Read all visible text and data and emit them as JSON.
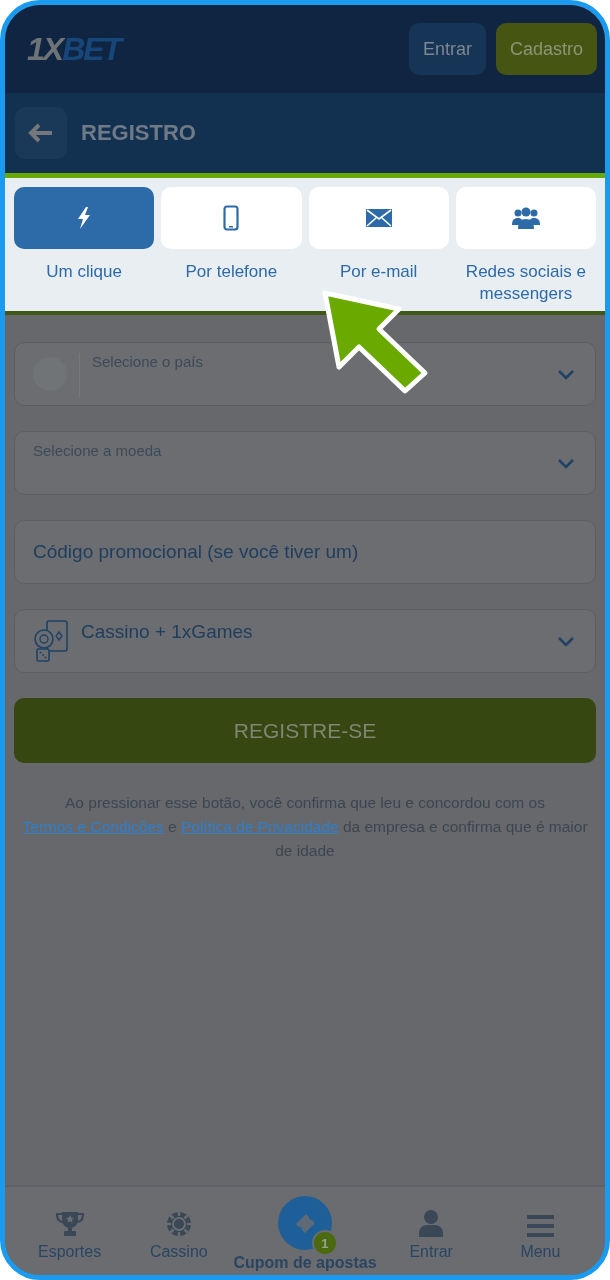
{
  "header": {
    "logo": {
      "prefix": "1X",
      "suffix": "BET"
    },
    "buttons": [
      {
        "kind": "login",
        "label": "Entrar"
      },
      {
        "kind": "signup",
        "label": "Cadastro"
      }
    ]
  },
  "page_title": "REGISTRO",
  "methods": [
    {
      "label": "Um clique",
      "selected": true
    },
    {
      "label": "Por telefone",
      "selected": false
    },
    {
      "label": "Por e-mail",
      "selected": false
    },
    {
      "label": "Redes sociais e messengers",
      "selected": false
    }
  ],
  "fields": [
    {
      "kind": "country",
      "label": "Selecione o país"
    },
    {
      "kind": "select",
      "label": "Selecione a moeda"
    },
    {
      "kind": "input",
      "placeholder": "Código promocional (se você tiver um)"
    },
    {
      "kind": "bonus",
      "value": "Cassino + 1xGames"
    }
  ],
  "submit": "REGISTRE-SE",
  "terms": [
    {
      "kind": "text",
      "text": "Ao pressionar esse botão, você confirma que leu e concordou com os "
    },
    {
      "kind": "link",
      "text": "Termos e Condições"
    },
    {
      "kind": "text",
      "text": " e "
    },
    {
      "kind": "link",
      "text": "Política de Privacidade"
    },
    {
      "kind": "text",
      "text": " da empresa e confirma que é maior de idade"
    }
  ],
  "nav": [
    {
      "kind": "plain",
      "label": "Esportes"
    },
    {
      "kind": "plain",
      "label": "Cassino"
    },
    {
      "kind": "coupon",
      "label": "Cupom de apostas",
      "badge": "1"
    },
    {
      "kind": "plain",
      "label": "Entrar"
    },
    {
      "kind": "plain",
      "label": "Menu"
    }
  ]
}
